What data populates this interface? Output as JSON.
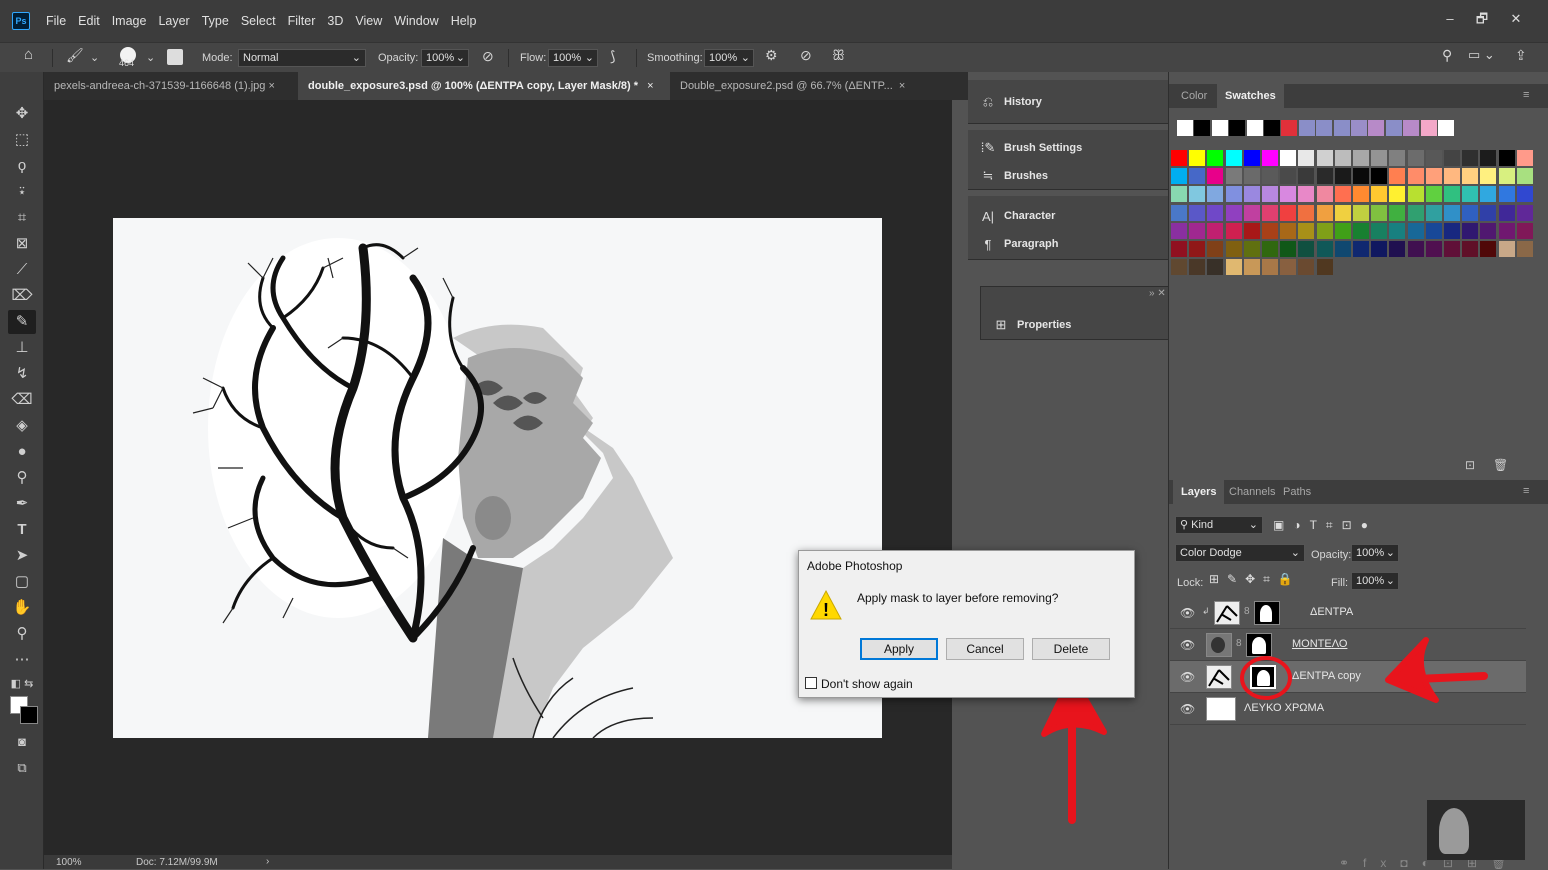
{
  "app": {
    "logo": "Ps"
  },
  "menu": [
    "File",
    "Edit",
    "Image",
    "Layer",
    "Type",
    "Select",
    "Filter",
    "3D",
    "View",
    "Window",
    "Help"
  ],
  "window_controls": {
    "minimize": "–",
    "restore": "🗗",
    "close": "✕"
  },
  "options": {
    "brush_size": "464",
    "mode_label": "Mode:",
    "mode_value": "Normal",
    "opacity_label": "Opacity:",
    "opacity_value": "100%",
    "flow_label": "Flow:",
    "flow_value": "100%",
    "smoothing_label": "Smoothing:",
    "smoothing_value": "100%"
  },
  "tabs": [
    {
      "label": "pexels-andreea-ch-371539-1166648 (1).jpg",
      "close": "×"
    },
    {
      "label": "double_exposure3.psd @ 100% (ΔΕΝΤΡΑ copy, Layer Mask/8) *",
      "close": "×"
    },
    {
      "label": "Double_exposure2.psd @ 66.7% (ΔΕΝΤΡ...",
      "close": "×"
    }
  ],
  "status": {
    "zoom": "100%",
    "doc": "Doc: 7.12M/99.9M",
    "arrow": "›"
  },
  "middock": {
    "history": "History",
    "brush_settings": "Brush Settings",
    "brushes": "Brushes",
    "character": "Character",
    "paragraph": "Paragraph",
    "properties": "Properties"
  },
  "color_panel": {
    "tab_color": "Color",
    "tab_swatches": "Swatches"
  },
  "swatch_colors": {
    "recent": [
      "#ffffff",
      "#000000",
      "#ffffff",
      "#000000",
      "#ffffff",
      "#000000",
      "#e0303a",
      "#8a8ec8",
      "#8a8ec8",
      "#8a8ec8",
      "#9a8ec8",
      "#b78ac8",
      "#8a8ec8",
      "#b78ac8",
      "#f3a8c8",
      "#ffffff"
    ],
    "rows": [
      [
        "#ff0000",
        "#ffff00",
        "#00ff00",
        "#00ffff",
        "#0000ff",
        "#ff00ff",
        "#ffffff",
        "#e8e8e8",
        "#d0d0d0",
        "#bcbcbc",
        "#a8a8a8",
        "#949494",
        "#808080",
        "#6c6c6c",
        "#585858",
        "#444444",
        "#303030",
        "#1c1c1c",
        "#000000",
        "#ff9a8a",
        "#ffc08a",
        "#fff38a",
        "#c8f08a",
        "#8ae08a"
      ],
      [
        "#00aef0",
        "#4668c8",
        "#e8008a",
        "#7a7a7a",
        "#6a6a6a",
        "#5a5a5a",
        "#4a4a4a",
        "#3a3a3a",
        "#2a2a2a",
        "#1a1a1a",
        "#0a0a0a",
        "#000000",
        "#ff7f50",
        "#ff8c69",
        "#ffa07a",
        "#ffb880",
        "#ffd080",
        "#fff080",
        "#d8f080",
        "#a8e080",
        "#80d8a0",
        "#80d8c8",
        "#80c8e8",
        "#80a8e8"
      ],
      [
        "#88d8b0",
        "#80c8e0",
        "#80a8e0",
        "#8090e0",
        "#9a88e0",
        "#b888e0",
        "#d888e0",
        "#e888c8",
        "#f088a0",
        "#ff6f50",
        "#ff8a30",
        "#ffc830",
        "#fff030",
        "#b8e030",
        "#60d040",
        "#30c080",
        "#30c0b0",
        "#30a8e0",
        "#3078e0",
        "#3048d0",
        "#5030c0",
        "#8030c0",
        "#b030c0",
        "#d03090"
      ],
      [
        "#4a78c8",
        "#5a58c8",
        "#7048c8",
        "#9040c0",
        "#c040a0",
        "#e04070",
        "#f04040",
        "#f07040",
        "#f0a040",
        "#f0d040",
        "#c0d040",
        "#80c040",
        "#40b040",
        "#30a070",
        "#30a0a0",
        "#3090c8",
        "#3060c0",
        "#3040a8",
        "#402898",
        "#602898",
        "#802898",
        "#a02880",
        "#c02860",
        "#a01818"
      ],
      [
        "#8a2fa0",
        "#a02890",
        "#c02070",
        "#d02050",
        "#a81818",
        "#a84018",
        "#a86818",
        "#a89018",
        "#80a018",
        "#40a018",
        "#188030",
        "#188060",
        "#188080",
        "#186898",
        "#184898",
        "#182880",
        "#301870",
        "#501870",
        "#701870",
        "#801858",
        "#901840",
        "#701010",
        "#c8a080",
        "#a08060"
      ],
      [
        "#901020",
        "#901818",
        "#804018",
        "#806010",
        "#607010",
        "#306810",
        "#105818",
        "#105040",
        "#105858",
        "#104870",
        "#102870",
        "#101860",
        "#201050",
        "#401050",
        "#501050",
        "#601038",
        "#601028",
        "#500808",
        "#c8a888",
        "#8a6848",
        "#6a4830",
        "#4a3020",
        "#d8b890",
        "#b89068"
      ],
      [
        "#604830",
        "#4a3828",
        "#383028",
        "#e0b870",
        "#c89858",
        "#a87848",
        "#886040",
        "#6a4a30",
        "#503820"
      ]
    ]
  },
  "layers_panel": {
    "tab_layers": "Layers",
    "tab_channels": "Channels",
    "tab_paths": "Paths",
    "kind": "Kind",
    "blend_mode": "Color Dodge",
    "opacity_label": "Opacity:",
    "opacity_value": "100%",
    "lock_label": "Lock:",
    "fill_label": "Fill:",
    "fill_value": "100%",
    "layers": [
      {
        "name": "ΔΕΝΤΡΑ",
        "selected": false
      },
      {
        "name": "ΜΟΝΤΕΛΟ",
        "selected": false
      },
      {
        "name": "ΔΕΝΤΡΑ copy",
        "selected": true
      },
      {
        "name": "ΛΕΥΚΟ ΧΡΩΜΑ",
        "selected": false
      }
    ]
  },
  "dialog": {
    "title": "Adobe Photoshop",
    "message": "Apply mask to layer before removing?",
    "apply": "Apply",
    "cancel": "Cancel",
    "delete": "Delete",
    "dont_show": "Don't show again"
  },
  "colors": {
    "annotation_red": "#e8141c",
    "accent_blue": "#0078d7",
    "warning_yellow": "#ffd800"
  }
}
